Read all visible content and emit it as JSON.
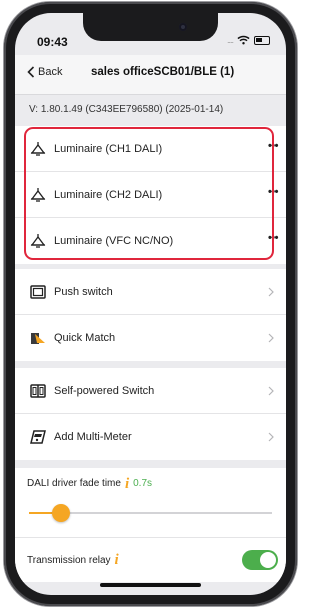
{
  "status_bar": {
    "time": "09:43",
    "signal_dots": "....",
    "icons": [
      "wifi-icon",
      "battery-icon"
    ]
  },
  "navbar": {
    "back_label": "Back",
    "title": "sales officeSCB01/BLE (1)"
  },
  "version_text": "V: 1.80.1.49  (C343EE796580) (2025-01-14)",
  "luminaires": [
    {
      "label": "Luminaire (CH1 DALI)",
      "more": "•••",
      "icon": "luminaire-icon"
    },
    {
      "label": "Luminaire (CH2 DALI)",
      "more": "•••",
      "icon": "luminaire-icon"
    },
    {
      "label": "Luminaire (VFC NC/NO)",
      "more": "•••",
      "icon": "luminaire-icon"
    }
  ],
  "devices_group_1": [
    {
      "label": "Push switch",
      "icon": "push-switch-icon"
    },
    {
      "label": "Quick Match",
      "icon": "quick-match-icon"
    }
  ],
  "devices_group_2": [
    {
      "label": "Self-powered Switch",
      "icon": "self-powered-switch-icon"
    },
    {
      "label": "Add Multi-Meter",
      "icon": "multi-meter-icon"
    }
  ],
  "fade": {
    "label": "DALI driver fade time",
    "info": "i",
    "value": "0.7s",
    "slider_fraction": 0.13
  },
  "relay": {
    "label": "Transmission relay",
    "info": "i",
    "enabled": true
  },
  "colors": {
    "highlight": "#e0263c",
    "accent": "#f5a623",
    "toggle_on": "#4cae4c",
    "value_green": "#4caf50"
  }
}
